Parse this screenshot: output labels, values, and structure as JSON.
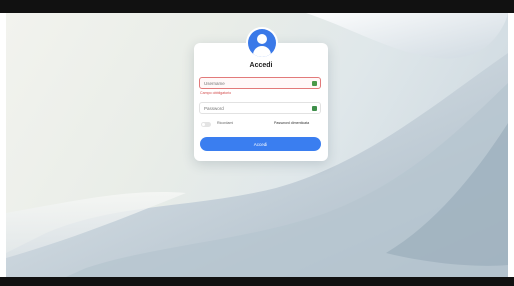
{
  "login": {
    "title": "Accedi",
    "username_placeholder": "Username",
    "username_value": "",
    "username_error": "Campo obbligatorio",
    "password_placeholder": "Password",
    "remember_label": "Ricordami",
    "remember_checked": false,
    "forgot_label": "Password dimenticata",
    "submit_label": "Accedi"
  },
  "icons": {
    "avatar": "user-circle-icon",
    "username_field": "key-icon",
    "password_field": "key-icon"
  },
  "colors": {
    "accent": "#3a7ef0",
    "error": "#d34a4a",
    "field_icon": "#4a9a49"
  }
}
